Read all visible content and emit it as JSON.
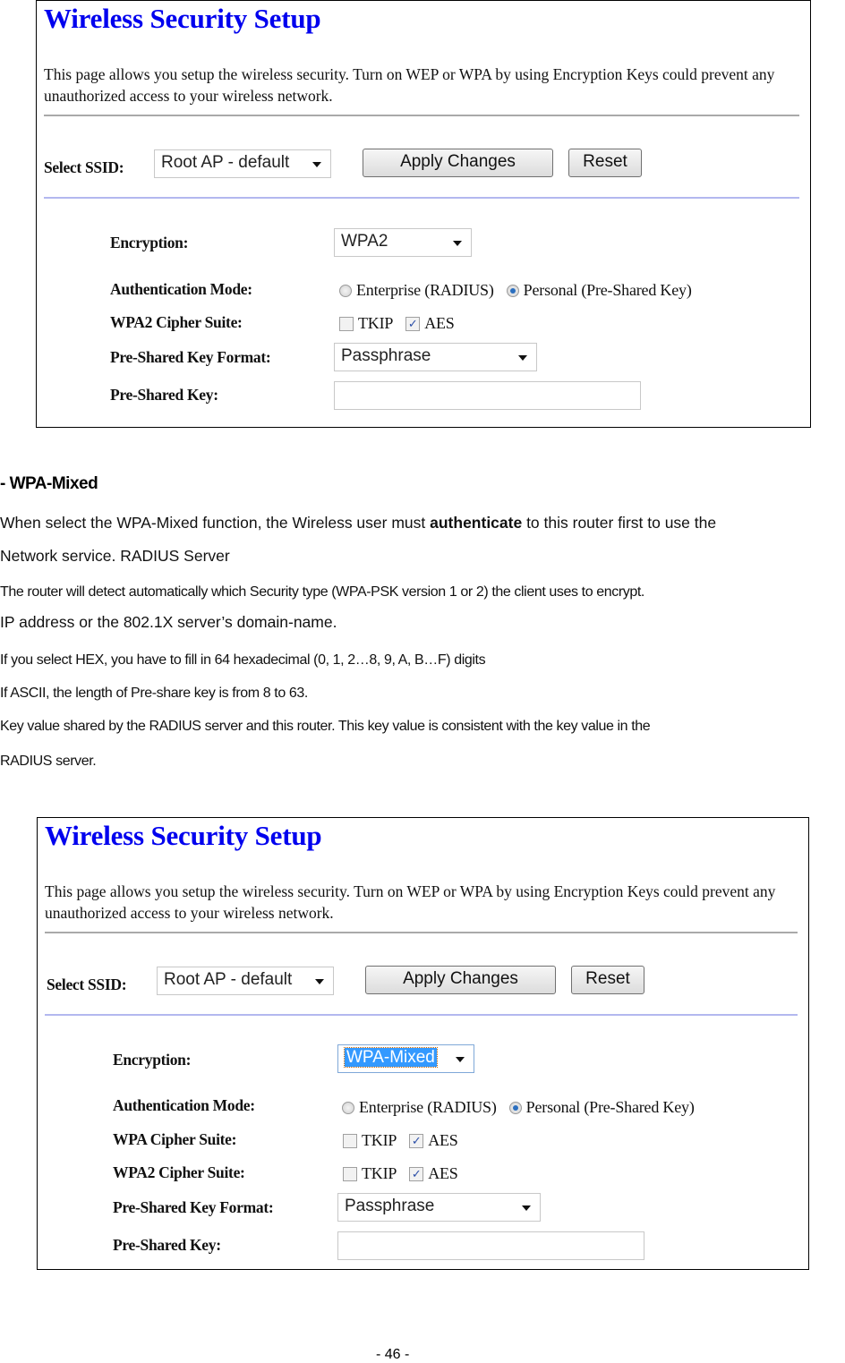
{
  "screenshot_top": {
    "title": "Wireless Security Setup",
    "description": "This page allows you setup the wireless security. Turn on WEP or WPA by using Encryption Keys could prevent any unauthorized access to your wireless network.",
    "ssid_label": "Select SSID:",
    "ssid_value": "Root AP - default",
    "apply_button": "Apply Changes",
    "reset_button": "Reset",
    "encryption_label": "Encryption:",
    "encryption_value": "WPA2",
    "auth_mode_label": "Authentication Mode:",
    "auth_options": [
      {
        "label": "Enterprise (RADIUS)",
        "selected": false
      },
      {
        "label": "Personal (Pre-Shared Key)",
        "selected": true
      }
    ],
    "wpa2_cipher_label": "WPA2 Cipher Suite:",
    "wpa2_ciphers": [
      {
        "label": "TKIP",
        "checked": false
      },
      {
        "label": "AES",
        "checked": true
      }
    ],
    "psk_format_label": "Pre-Shared Key Format:",
    "psk_format_value": "Passphrase",
    "psk_label": "Pre-Shared Key:",
    "psk_value": ""
  },
  "doc": {
    "heading": "- WPA-Mixed",
    "para1_before": "When select the WPA-Mixed function, the Wireless user must ",
    "para1_bold": "authenticate",
    "para1_after": " to this router first to use the",
    "para1_line2": "Network service. RADIUS Server",
    "line3": "The router will detect automatically which Security type (WPA-PSK version 1 or 2) the client uses to encrypt.",
    "line4": "IP address or the 802.1X server’s domain-name.",
    "line5": "If you select HEX, you have to fill in 64 hexadecimal (0, 1, 2…8, 9, A, B…F) digits",
    "line6": "If ASCII, the length of Pre-share key is from 8 to 63.",
    "line7": "Key value shared by the RADIUS server and this router. This key value is consistent with the key value in the",
    "line8": "RADIUS server."
  },
  "screenshot_bottom": {
    "title": "Wireless Security Setup",
    "description": "This page allows you setup the wireless security. Turn on WEP or WPA by using Encryption Keys could prevent any unauthorized access to your wireless network.",
    "ssid_label": "Select SSID:",
    "ssid_value": "Root AP - default",
    "apply_button": "Apply Changes",
    "reset_button": "Reset",
    "encryption_label": "Encryption:",
    "encryption_value": "WPA-Mixed",
    "auth_mode_label": "Authentication Mode:",
    "auth_options": [
      {
        "label": "Enterprise (RADIUS)",
        "selected": false
      },
      {
        "label": "Personal (Pre-Shared Key)",
        "selected": true
      }
    ],
    "wpa_cipher_label": "WPA Cipher Suite:",
    "wpa_ciphers": [
      {
        "label": "TKIP",
        "checked": false
      },
      {
        "label": "AES",
        "checked": true
      }
    ],
    "wpa2_cipher_label": "WPA2 Cipher Suite:",
    "wpa2_ciphers": [
      {
        "label": "TKIP",
        "checked": false
      },
      {
        "label": "AES",
        "checked": true
      }
    ],
    "psk_format_label": "Pre-Shared Key Format:",
    "psk_format_value": "Passphrase",
    "psk_label": "Pre-Shared Key:",
    "psk_value": ""
  },
  "footer": {
    "page_number": "- 46 -"
  }
}
